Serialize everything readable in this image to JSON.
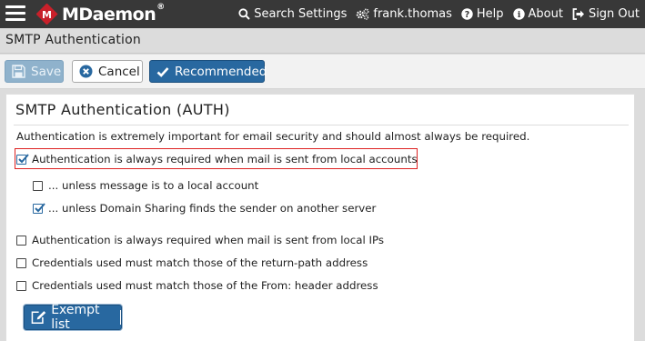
{
  "topbar": {
    "logo_text": "MDaemon",
    "logo_reg": "®",
    "nav": {
      "search": "Search Settings",
      "user": "frank.thomas",
      "help": "Help",
      "about": "About",
      "signout": "Sign Out"
    }
  },
  "page": {
    "title": "SMTP Authentication"
  },
  "toolbar": {
    "save": "Save",
    "cancel": "Cancel",
    "recommended": "Recommended"
  },
  "panel": {
    "heading": "SMTP Authentication (AUTH)",
    "intro": "Authentication is extremely important for email security and should almost always be required.",
    "options": [
      {
        "label": "Authentication is always required when mail is sent from local accounts",
        "checked": true
      },
      {
        "label": "... unless message is to a local account",
        "checked": false
      },
      {
        "label": "... unless Domain Sharing finds the sender on another server",
        "checked": true
      },
      {
        "label": "Authentication is always required when mail is sent from local IPs",
        "checked": false
      },
      {
        "label": "Credentials used must match those of the return-path address",
        "checked": false
      },
      {
        "label": "Credentials used must match those of the From: header address",
        "checked": false
      }
    ],
    "exempt_button": "Exempt list"
  },
  "colors": {
    "topbar": "#383838",
    "primary": "#2868a0",
    "logo_red": "#c8202a",
    "highlight": "#dd2222"
  },
  "icons": {
    "menu": "hamburger-icon",
    "search": "magnifier-icon",
    "user": "cogs-icon",
    "help": "question-circle-icon",
    "about": "info-circle-icon",
    "signout": "sign-out-icon",
    "save": "floppy-disk-icon",
    "cancel": "x-circle-icon",
    "recommended": "checkmark-icon",
    "exempt": "edit-icon"
  }
}
